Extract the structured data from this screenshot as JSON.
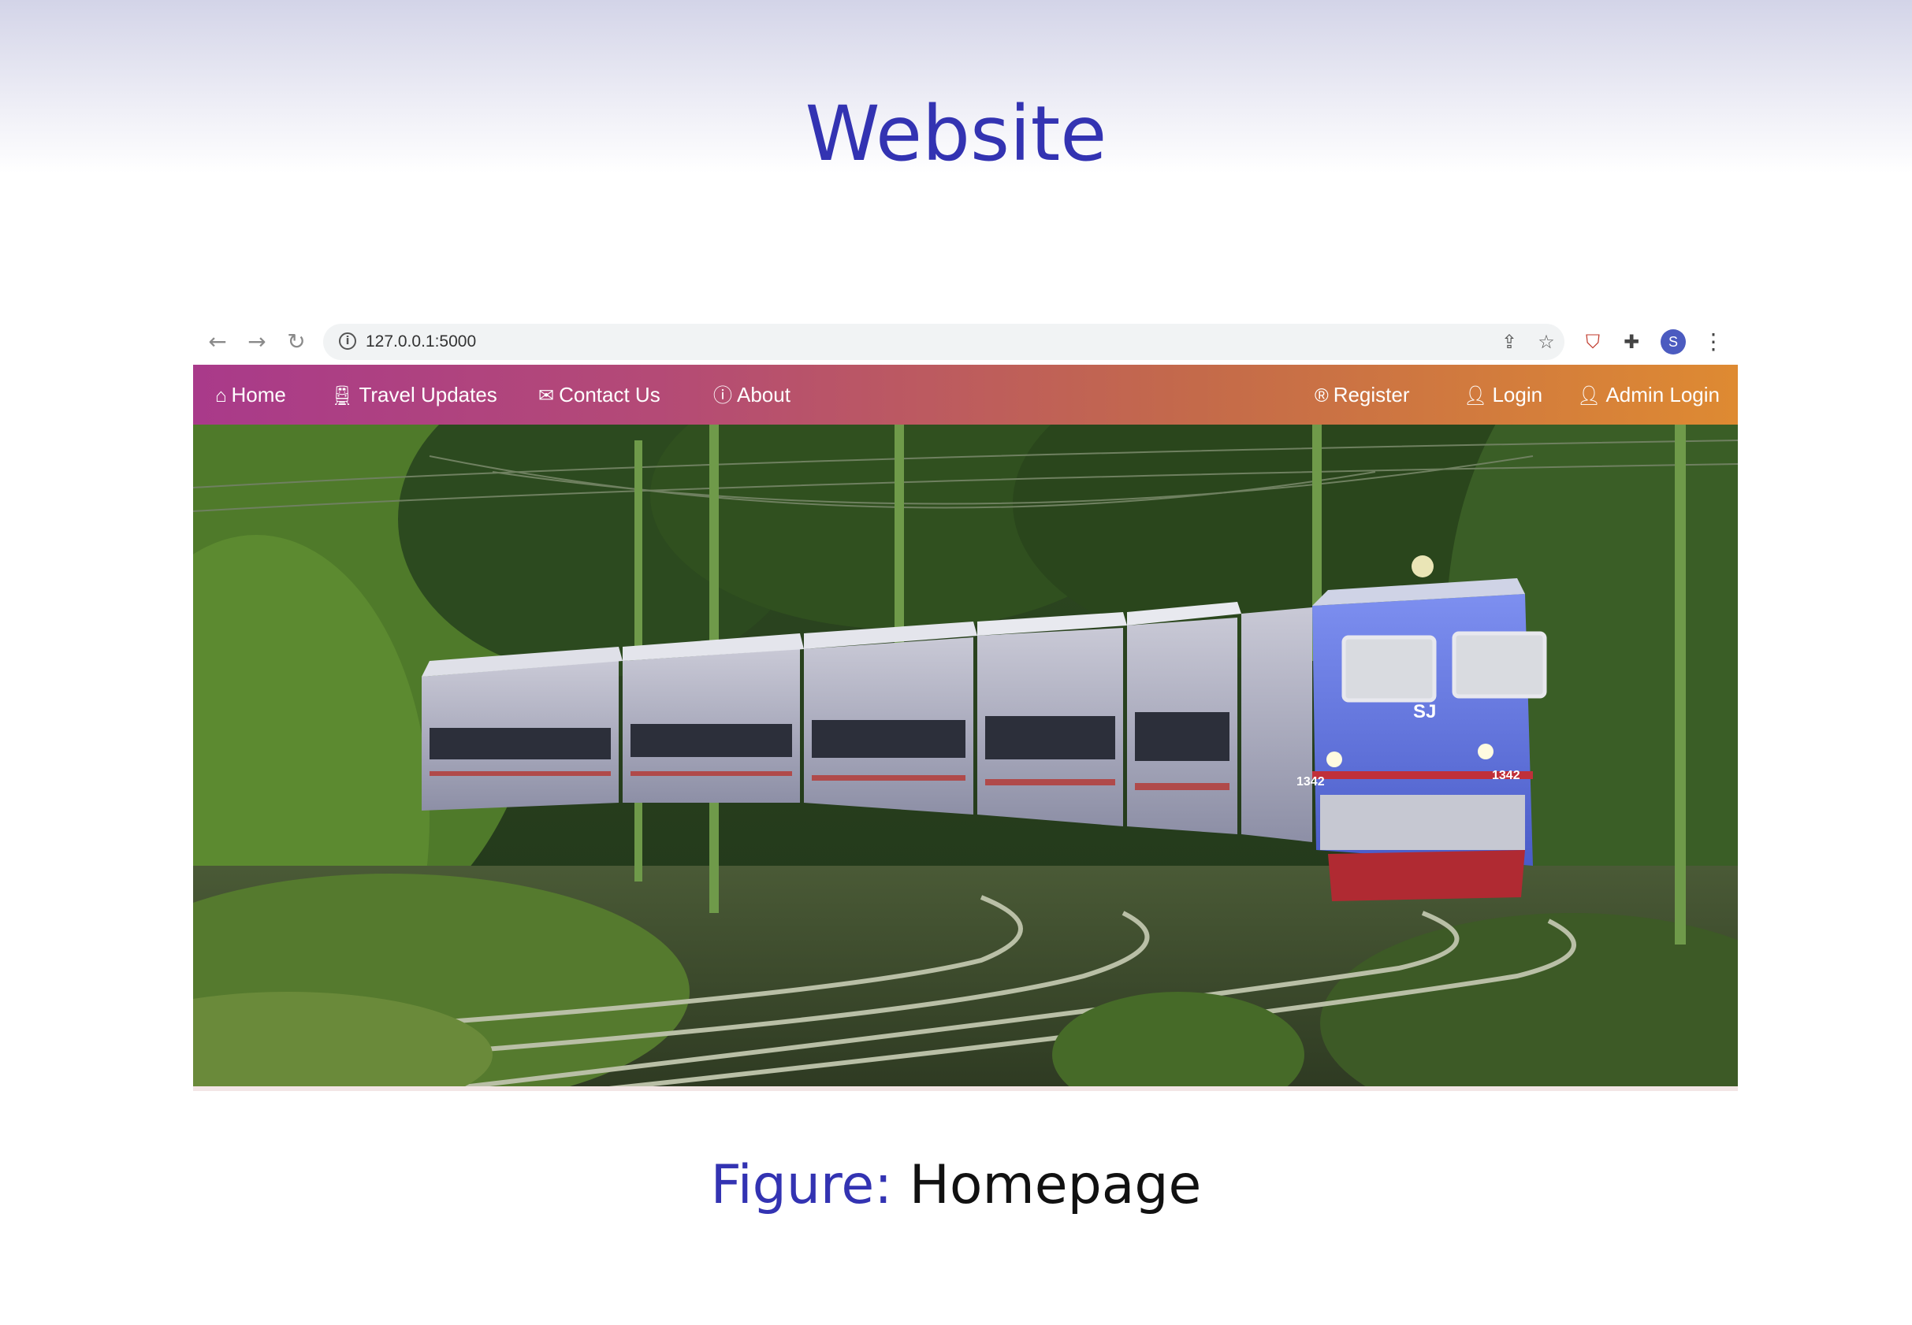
{
  "slide": {
    "title": "Website",
    "caption_label": "Figure:",
    "caption_text": "Homepage"
  },
  "browser": {
    "url": "127.0.0.1:5000",
    "avatar_letter": "S"
  },
  "site_nav": {
    "left": [
      {
        "label": "Home",
        "icon": "home-icon"
      },
      {
        "label": "Travel Updates",
        "icon": "train-icon"
      },
      {
        "label": "Contact Us",
        "icon": "envelope-icon"
      },
      {
        "label": "About",
        "icon": "info-icon"
      }
    ],
    "right": [
      {
        "label": "Register",
        "icon": "registered-icon"
      },
      {
        "label": "Login",
        "icon": "user-icon"
      },
      {
        "label": "Admin Login",
        "icon": "user-icon"
      }
    ]
  },
  "hero": {
    "locomotive_number": "1342",
    "logo_text": "SJ"
  },
  "colors": {
    "title": "#3333b2",
    "nav_start": "#a93a8a",
    "nav_end": "#de8a32",
    "locomotive": "#5a6fd8"
  }
}
